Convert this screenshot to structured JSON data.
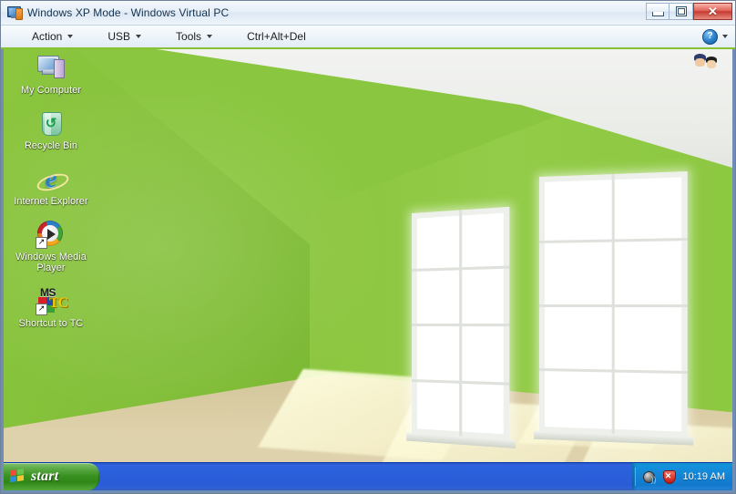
{
  "window": {
    "title": "Windows XP Mode - Windows Virtual PC",
    "icon": "virtual-pc-icon",
    "controls": {
      "minimize": "Minimize",
      "restore": "Restore",
      "close": "Close",
      "close_glyph": "✕",
      "minimize_glyph": "—",
      "restore_glyph": "□"
    }
  },
  "menubar": {
    "items": [
      {
        "label": "Action",
        "has_dropdown": true
      },
      {
        "label": "USB",
        "has_dropdown": true
      },
      {
        "label": "Tools",
        "has_dropdown": true
      },
      {
        "label": "Ctrl+Alt+Del",
        "has_dropdown": false
      }
    ],
    "help": {
      "glyph": "?",
      "label": "Help",
      "has_dropdown": true
    }
  },
  "desktop": {
    "wallpaper_description": "Green room interior with two bright windows and sunlit floor",
    "colors": {
      "wall_green": "#8cc63f",
      "ceiling_white": "#eceeea",
      "floor_tan": "#d5c79c",
      "taskbar_blue": "#2a5cd6",
      "start_green": "#389220",
      "tray_blue": "#1385d6"
    },
    "icons": [
      {
        "label": "My Computer",
        "icon": "my-computer-icon",
        "shortcut": false
      },
      {
        "label": "Recycle Bin",
        "icon": "recycle-bin-icon",
        "shortcut": false
      },
      {
        "label": "Internet Explorer",
        "icon": "internet-explorer-icon",
        "shortcut": false
      },
      {
        "label": "Windows Media Player",
        "icon": "windows-media-player-icon",
        "shortcut": true
      },
      {
        "label": "Shortcut to TC",
        "icon": "ms-dos-tc-icon",
        "shortcut": true,
        "badge_text": "MS",
        "badge_text2": "TC"
      }
    ],
    "pet": {
      "name": "desktop-pet-sprite"
    }
  },
  "taskbar": {
    "start_label": "start",
    "tray": {
      "icons": [
        {
          "name": "volume-icon",
          "label": "Volume"
        },
        {
          "name": "security-shield-icon",
          "label": "Security Alerts",
          "glyph": "✕"
        }
      ],
      "clock": "10:19 AM"
    }
  }
}
